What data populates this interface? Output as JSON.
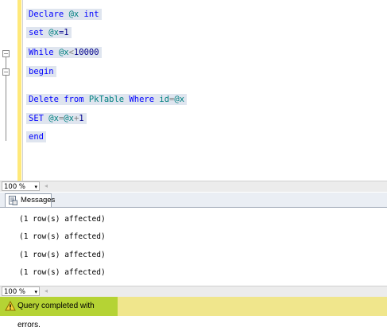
{
  "editor": {
    "lines": [
      {
        "parts": [
          {
            "t": "Declare ",
            "c": "kw"
          },
          {
            "t": "@x",
            "c": "var"
          },
          {
            "t": " int",
            "c": "kw"
          }
        ]
      },
      {
        "parts": [
          {
            "t": "set ",
            "c": "kw"
          },
          {
            "t": "@x",
            "c": "var"
          },
          {
            "t": "=1",
            "c": ""
          }
        ]
      },
      {
        "parts": [
          {
            "t": "While ",
            "c": "kw"
          },
          {
            "t": "@x",
            "c": "var"
          },
          {
            "t": "<",
            "c": "gray"
          },
          {
            "t": "10000",
            "c": ""
          }
        ]
      },
      {
        "parts": [
          {
            "t": "begin",
            "c": "kw"
          }
        ]
      },
      {
        "parts": [
          {
            "t": "Delete from ",
            "c": "kw"
          },
          {
            "t": "PkTable",
            "c": "var"
          },
          {
            "t": " Where ",
            "c": "kw"
          },
          {
            "t": "id",
            "c": "var"
          },
          {
            "t": "=",
            "c": "gray"
          },
          {
            "t": "@x",
            "c": "var"
          }
        ]
      },
      {
        "parts": [
          {
            "t": "SET ",
            "c": "kw"
          },
          {
            "t": "@x",
            "c": "var"
          },
          {
            "t": "=",
            "c": "gray"
          },
          {
            "t": "@x",
            "c": "var"
          },
          {
            "t": "+",
            "c": "gray"
          },
          {
            "t": "1",
            "c": ""
          }
        ]
      },
      {
        "parts": [
          {
            "t": "end",
            "c": "kw"
          }
        ]
      }
    ]
  },
  "zoom_top": {
    "value": "100 %",
    "arrow": "▾",
    "scroll_left": "◂"
  },
  "tabs": {
    "messages_label": "Messages"
  },
  "messages": {
    "lines": [
      "(1 row(s) affected)",
      "(1 row(s) affected)",
      "(1 row(s) affected)",
      "(1 row(s) affected)"
    ]
  },
  "zoom_bottom": {
    "value": "100 %",
    "arrow": "▾",
    "scroll_left": "◂"
  },
  "status": {
    "text": "Query completed with errors.",
    "icon": "warning-icon"
  },
  "colors": {
    "status_bar": "#f0e68c",
    "status_highlight": "#b5d334",
    "selection": "#dfe5ef"
  }
}
